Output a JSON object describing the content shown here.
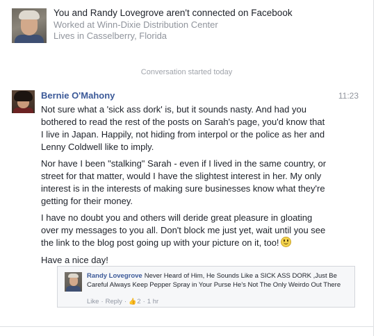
{
  "header": {
    "title": "You and Randy Lovegrove aren't connected on Facebook",
    "work": "Worked at Winn-Dixie Distribution Center",
    "location": "Lives in Casselberry, Florida"
  },
  "conversation": {
    "started_label": "Conversation started today"
  },
  "message": {
    "sender": "Bernie O'Mahony",
    "time": "11:23",
    "paragraphs": [
      "Not sure what a 'sick ass dork' is, but it sounds nasty.  And had you bothered to read the rest of the posts on Sarah's page, you'd know that I live in Japan. Happily, not hiding from interpol or the police as her and Lenny Coldwell like to imply.",
      "Nor have I been \"stalking\" Sarah - even if I lived in the same country, or street for that matter, would I have the slightest interest in her. My only interest is in the interests of making sure businesses know what they're getting for their money.",
      "I have no doubt you and others will deride great pleasure in gloating over my messages to you all. Don't block me just yet, wait until you see the link to the blog post going up with your picture on it, too!",
      "Have a nice day!"
    ],
    "emoji_icon": "smiley-icon"
  },
  "embedded_comment": {
    "author": "Randy Lovegrove",
    "text": "Never Heard of Him, He Sounds Like a SICK ASS DORK ,Just Be Careful Always Keep Pepper Spray in Your Purse He's Not The Only Weirdo Out There",
    "like_label": "Like",
    "reply_label": "Reply",
    "like_count": "2",
    "age": "1 hr",
    "like_icon": "thumbs-up-icon"
  }
}
